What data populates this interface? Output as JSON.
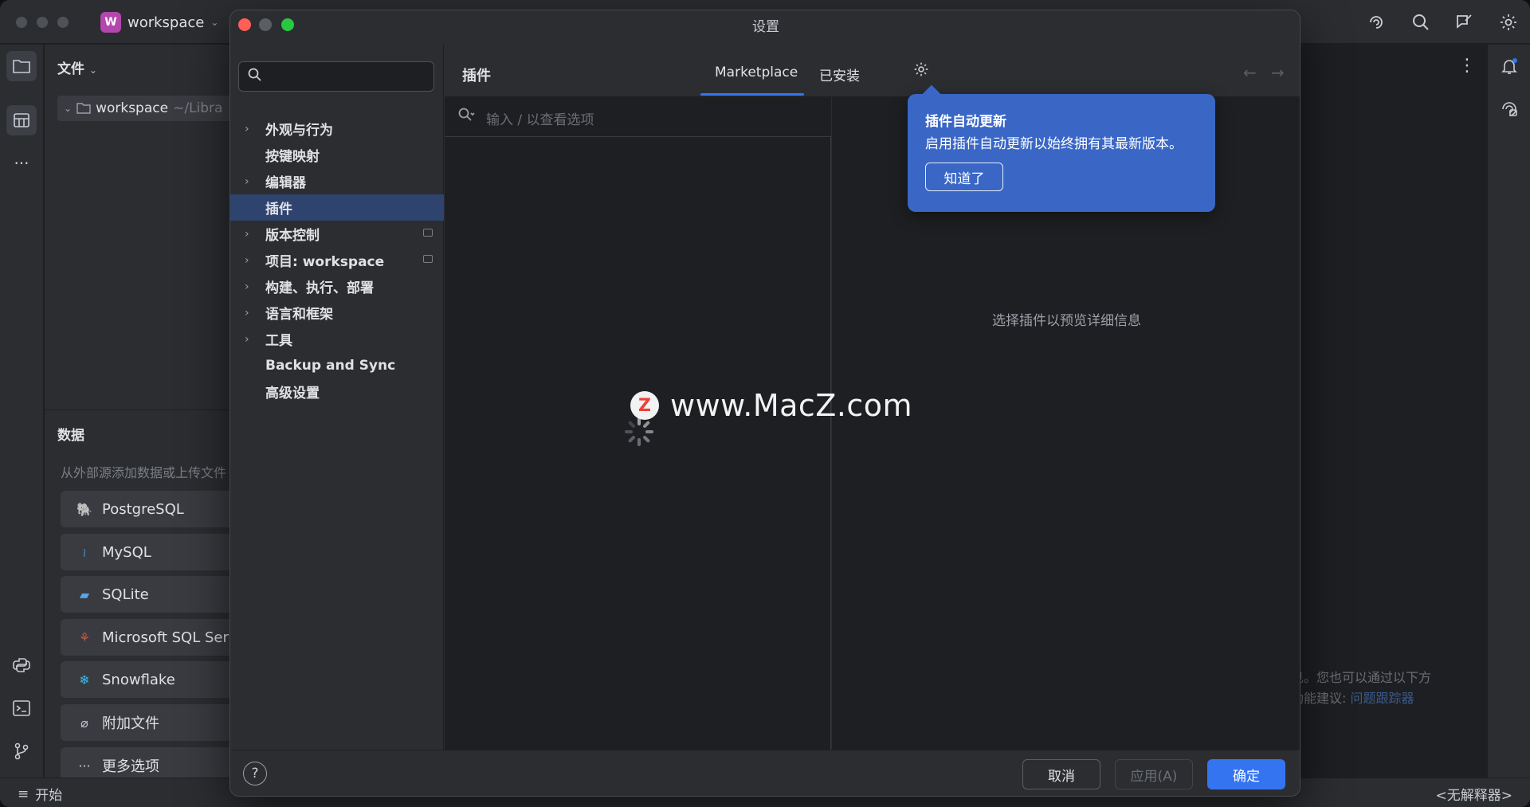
{
  "ide": {
    "project_badge": "W",
    "project_name": "workspace",
    "file_panel_title": "文件",
    "tree_root": "workspace",
    "tree_root_path": "~/Libra",
    "data_title": "数据",
    "data_subtitle": "从外部源添加数据或上传文件",
    "data_sources": [
      {
        "label": "PostgreSQL",
        "icon": "postgresql-icon"
      },
      {
        "label": "MySQL",
        "icon": "mysql-icon"
      },
      {
        "label": "SQLite",
        "icon": "sqlite-icon"
      },
      {
        "label": "Microsoft SQL Ser",
        "icon": "mssql-icon"
      },
      {
        "label": "Snowflake",
        "icon": "snowflake-icon"
      },
      {
        "label": "附加文件",
        "icon": "paperclip-icon"
      },
      {
        "label": "更多选项",
        "icon": "ellipsis-icon"
      }
    ],
    "editor_hint_line1": "见。您也可以通过以下方",
    "editor_hint_line2_prefix": "功能建议: ",
    "editor_hint_link": "问题跟踪器",
    "status_left": "开始",
    "status_right": "<无解释器>"
  },
  "dialog": {
    "title": "设置",
    "search_placeholder": "",
    "nav_items": [
      {
        "label": "外观与行为",
        "arrow": true
      },
      {
        "label": "按键映射",
        "arrow": false
      },
      {
        "label": "编辑器",
        "arrow": true
      },
      {
        "label": "插件",
        "arrow": false,
        "selected": true
      },
      {
        "label": "版本控制",
        "arrow": true,
        "project_icon": true
      },
      {
        "label": "项目: workspace",
        "arrow": true,
        "project_icon": true
      },
      {
        "label": "构建、执行、部署",
        "arrow": true
      },
      {
        "label": "语言和框架",
        "arrow": true
      },
      {
        "label": "工具",
        "arrow": true
      },
      {
        "label": "Backup and Sync",
        "arrow": false
      },
      {
        "label": "高级设置",
        "arrow": false
      }
    ],
    "content_title": "插件",
    "tabs": {
      "marketplace": "Marketplace",
      "installed": "已安装"
    },
    "plugin_search_placeholder": "输入 / 以查看选项",
    "detail_placeholder": "选择插件以预览详细信息",
    "popup": {
      "title": "插件自动更新",
      "body": "启用插件自动更新以始终拥有其最新版本。",
      "button": "知道了"
    },
    "watermark": {
      "logo": "Z",
      "text": "www.MacZ.com"
    },
    "footer": {
      "help": "?",
      "cancel": "取消",
      "apply": "应用(A)",
      "ok": "确定"
    }
  },
  "colors": {
    "accent": "#3574f0",
    "selection": "#2e436e",
    "popup": "#3a67c6",
    "close": "#ff5f57",
    "zoom": "#28c840"
  }
}
